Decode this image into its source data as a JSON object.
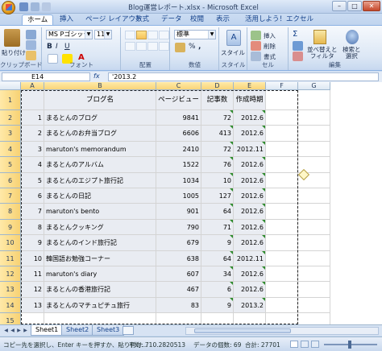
{
  "window": {
    "title": "Blog運営レポート.xlsx - Microsoft Excel",
    "minimize": "–",
    "maximize": "□",
    "close": "✕"
  },
  "ribbon": {
    "tabs": [
      "ホーム",
      "挿入",
      "ページ レイアウト",
      "数式",
      "データ",
      "校閲",
      "表示",
      "活用しよう！エクセル"
    ],
    "active_tab": "ホーム",
    "clipboard": {
      "label": "クリップボード",
      "paste": "貼り付け"
    },
    "font": {
      "label": "フォント",
      "name": "MS Pゴシック",
      "size": "11",
      "bold": "B",
      "italic": "I",
      "underline": "U",
      "color_a": "A"
    },
    "alignment": {
      "label": "配置"
    },
    "number": {
      "label": "数値",
      "format": "標準",
      "pct": "%",
      "comma": ","
    },
    "style": {
      "label": "スタイル",
      "button": "スタイル"
    },
    "cells": {
      "label": "セル",
      "insert": "挿入",
      "delete": "削除",
      "format": "書式"
    },
    "editing": {
      "label": "編集",
      "sort": "並べ替えと\nフィルタ",
      "find": "検索と\n選択",
      "sigma": "Σ"
    }
  },
  "formula_bar": {
    "name_box": "E14",
    "fx": "fx",
    "value": "'2013.2"
  },
  "grid": {
    "columns": [
      "A",
      "B",
      "C",
      "D",
      "E",
      "F",
      "G"
    ],
    "headers": [
      "ブログ名",
      "ページビュー",
      "記事数",
      "作成時期"
    ],
    "rows": [
      {
        "no": "1",
        "name": "まるとんのブログ",
        "pv": "9841",
        "posts": "72",
        "date": "2012.6"
      },
      {
        "no": "2",
        "name": "まるとんのお弁当ブログ",
        "pv": "6606",
        "posts": "413",
        "date": "2012.6"
      },
      {
        "no": "3",
        "name": "maruton's memorandum",
        "pv": "2410",
        "posts": "72",
        "date": "2012.11"
      },
      {
        "no": "4",
        "name": "まるとんのアルバム",
        "pv": "1522",
        "posts": "76",
        "date": "2012.6"
      },
      {
        "no": "5",
        "name": "まるとんのエジプト旅行記",
        "pv": "1034",
        "posts": "10",
        "date": "2012.6"
      },
      {
        "no": "6",
        "name": "まるとんの日記",
        "pv": "1005",
        "posts": "127",
        "date": "2012.6"
      },
      {
        "no": "7",
        "name": "maruton's bento",
        "pv": "901",
        "posts": "64",
        "date": "2012.6"
      },
      {
        "no": "8",
        "name": "まるとんクッキング",
        "pv": "790",
        "posts": "71",
        "date": "2012.6"
      },
      {
        "no": "9",
        "name": "まるとんのインド旅行記",
        "pv": "679",
        "posts": "9",
        "date": "2012.6"
      },
      {
        "no": "10",
        "name": "韓国語お勉強コーナー",
        "pv": "638",
        "posts": "64",
        "date": "2012.11"
      },
      {
        "no": "11",
        "name": "maruton's diary",
        "pv": "607",
        "posts": "34",
        "date": "2012.6"
      },
      {
        "no": "12",
        "name": "まるとんの香港旅行記",
        "pv": "467",
        "posts": "6",
        "date": "2012.6"
      },
      {
        "no": "13",
        "name": "まるとんのマチュピチュ旅行",
        "pv": "83",
        "posts": "9",
        "date": "2013.2"
      }
    ],
    "row_numbers": [
      "1",
      "2",
      "3",
      "4",
      "5",
      "6",
      "7",
      "8",
      "9",
      "10",
      "11",
      "12",
      "13",
      "14",
      "15"
    ]
  },
  "sheets": [
    "Sheet1",
    "Sheet2",
    "Sheet3"
  ],
  "status": {
    "message": "コピー先を選択し、Enter キーを押すか、貼り付け...",
    "average": "平均: 710.2820513",
    "count": "データの個数: 69",
    "sum": "合計: 27701"
  }
}
